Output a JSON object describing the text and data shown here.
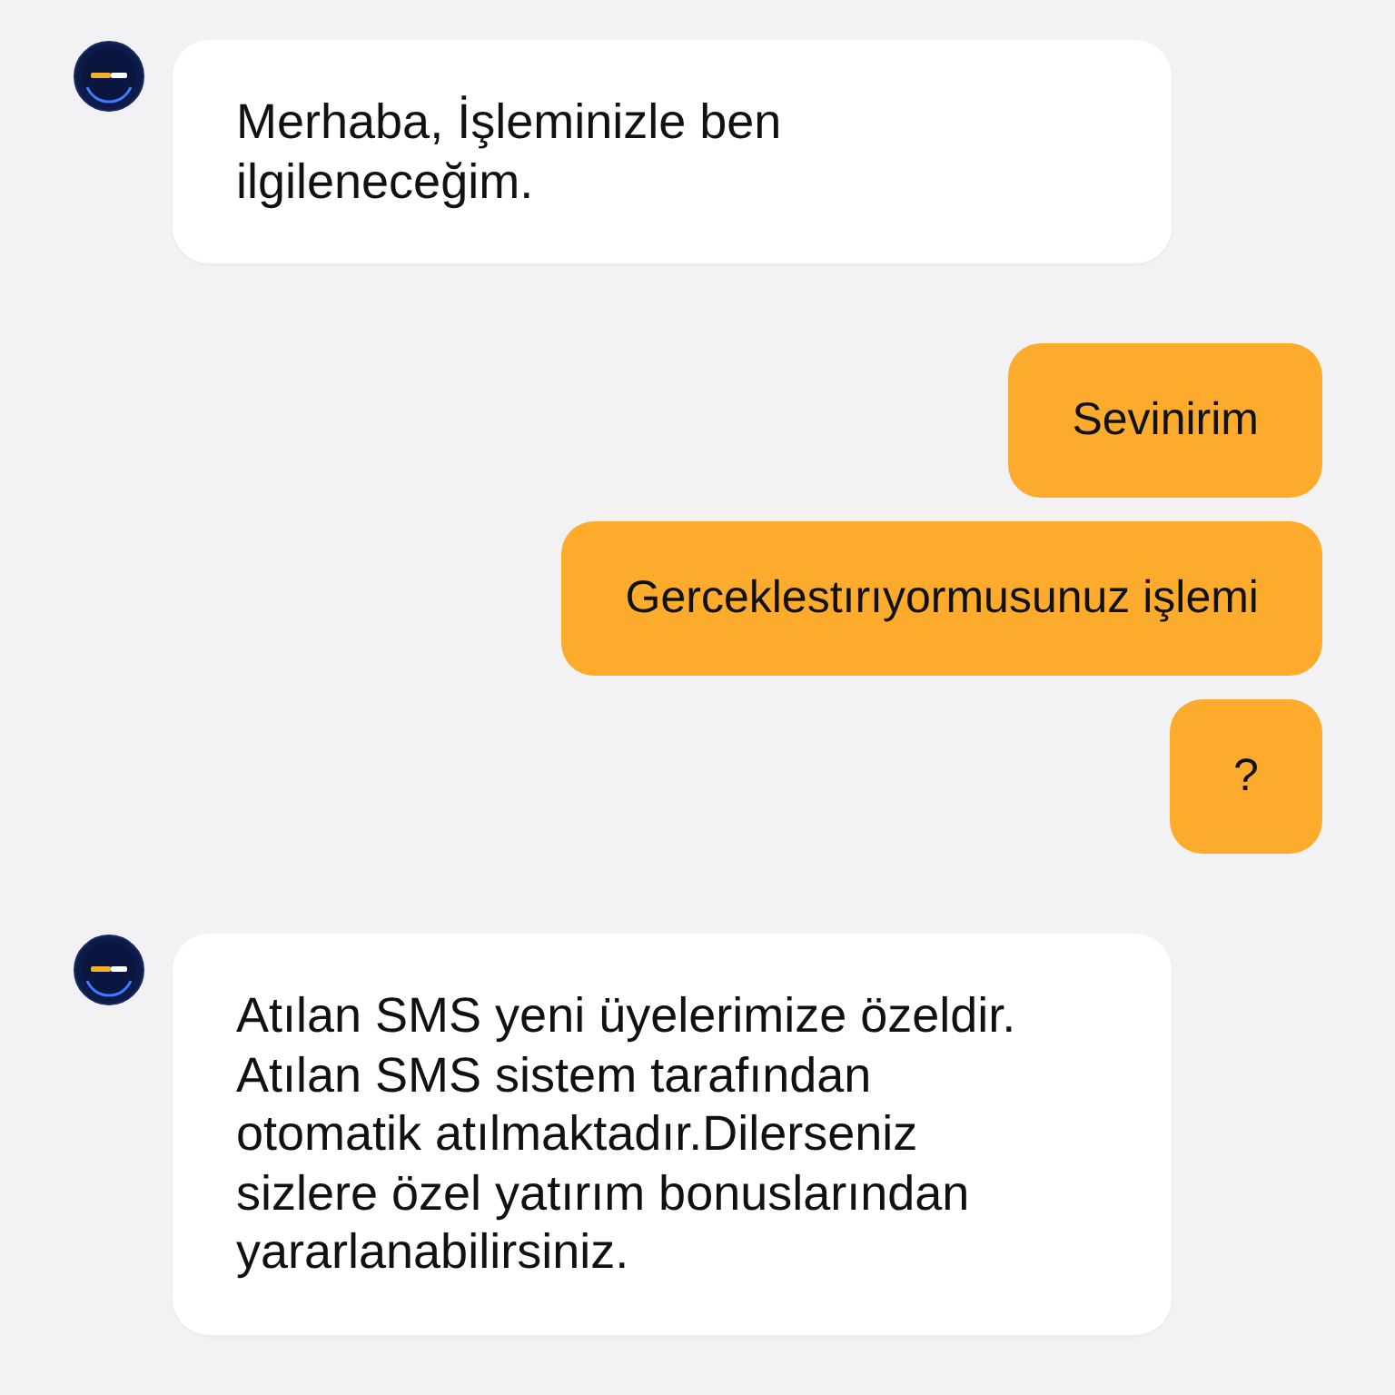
{
  "messages": [
    {
      "kind": "incoming",
      "text": "Merhaba, İşleminizle ben ilgileneceğim."
    },
    {
      "kind": "outgoing",
      "text": "Sevinirim"
    },
    {
      "kind": "outgoing",
      "text": "Gerceklestırıyormusunuz işlemi"
    },
    {
      "kind": "outgoing",
      "text": "?"
    },
    {
      "kind": "incoming",
      "text": "Atılan SMS yeni üyelerimize özeldir. Atılan SMS sistem tarafından otomatik atılmaktadır.Dilerseniz sizlere özel yatırım bonuslarından yararlanabilirsiniz."
    }
  ]
}
